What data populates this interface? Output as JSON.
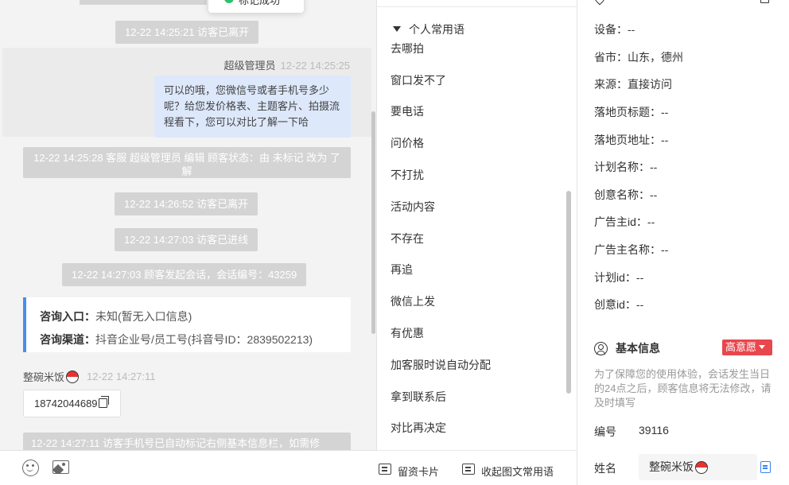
{
  "chat": {
    "toast_text": "标记成功",
    "sys1": "12-22 14:25:21 访客已离开",
    "agent_name": "超级管理员",
    "agent_time": "12-22 14:25:25",
    "agent_message": "可以的哦，您微信号或者手机号多少呢？给您发价格表、主题客片、拍摄流程看下，您可以对比了解一下哈",
    "sys2": "12-22 14:25:28 客服 超级管理员 编辑 顾客状态：由 未标记 改为 了解",
    "sys3": "12-22 14:26:52 访客已离开",
    "sys4": "12-22 14:27:03 访客已进线",
    "sys5": "12-22 14:27:03 顾客发起会话，会话编号：43259",
    "entry_label": "咨询入口：",
    "entry_value": "未知(暂无入口信息)",
    "channel_label": "咨询渠道：",
    "channel_value": "抖音企业号/员工号(抖音号ID：2839502213)",
    "customer_name": "整碗米饭",
    "customer_time": "12-22 14:27:11",
    "customer_phone": "18742044689",
    "sys6": "12-22 14:27:11 访客手机号已自动标记右侧基本信息栏，如需修"
  },
  "phrases": {
    "group_title": "个人常用语",
    "items": [
      "去哪拍",
      "窗口发不了",
      "要电话",
      "问价格",
      "不打扰",
      "活动内容",
      "不存在",
      "再追",
      "微信上发",
      "有优惠",
      "加客服时说自动分配",
      "拿到联系后",
      "对比再决定"
    ],
    "leave_card": "留资卡片",
    "collapse": "收起图文常用语"
  },
  "source_info": {
    "device_label": "设备：",
    "device_value": "--",
    "region_label": "省市：",
    "region_value": "山东，德州",
    "source_label": "来源：",
    "source_value": "直接访问",
    "lp_title_label": "落地页标题：",
    "lp_title_value": "--",
    "lp_url_label": "落地页地址：",
    "lp_url_value": "--",
    "plan_name_label": "计划名称：",
    "plan_name_value": "--",
    "creative_name_label": "创意名称：",
    "creative_name_value": "--",
    "adv_id_label": "广告主id：",
    "adv_id_value": "--",
    "adv_name_label": "广告主名称：",
    "adv_name_value": "--",
    "plan_id_label": "计划id：",
    "plan_id_value": "--",
    "creative_id_label": "创意id：",
    "creative_id_value": "--"
  },
  "basic_info": {
    "title": "基本信息",
    "intent_badge": "高意愿",
    "notice": "为了保障您的使用体验，会话发生当日的24点之后，顾客信息将无法修改，请及时填写",
    "id_label": "编号",
    "id_value": "39116",
    "name_label": "姓名",
    "name_value": "整碗米饭"
  },
  "colors": {
    "agent_bubble": "#dde8fb",
    "system_pill": "#d4d4d4",
    "intent_badge": "#e8474e",
    "card_border": "#4a8cf0"
  }
}
